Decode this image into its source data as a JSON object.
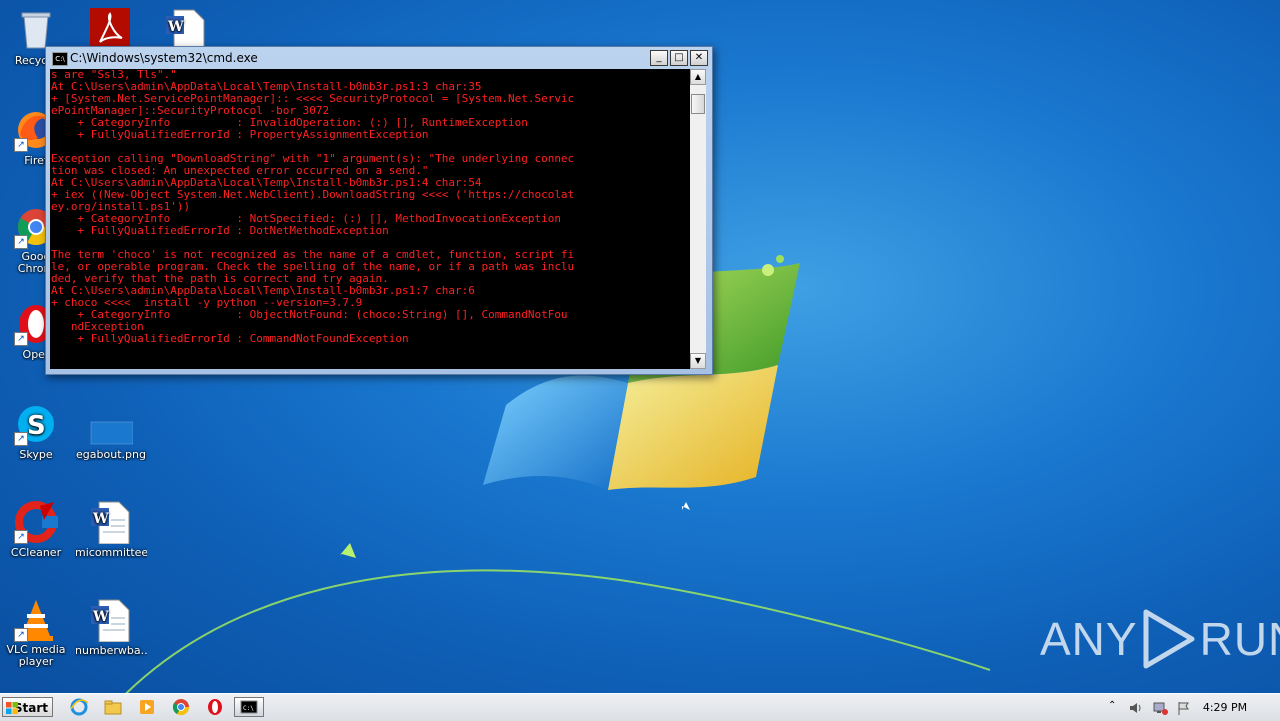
{
  "desktop": {
    "icons": [
      {
        "label": "Recycle"
      },
      {
        "label": "Firef"
      },
      {
        "label": "Goog\nChrom"
      },
      {
        "label": "Oper"
      },
      {
        "label": "Skype"
      },
      {
        "label": "egabout.png"
      },
      {
        "label": "CCleaner"
      },
      {
        "label": "micommittee..."
      },
      {
        "label": "VLC media\nplayer"
      },
      {
        "label": "numberwba..."
      }
    ]
  },
  "cmd": {
    "title": "C:\\Windows\\system32\\cmd.exe",
    "output": "s are \"Ssl3, Tls\".\"\nAt C:\\Users\\admin\\AppData\\Local\\Temp\\Install-b0mb3r.ps1:3 char:35\n+ [System.Net.ServicePointManager]:: <<<< SecurityProtocol = [System.Net.Servic\nePointManager]::SecurityProtocol -bor 3072\n    + CategoryInfo          : InvalidOperation: (:) [], RuntimeException\n    + FullyQualifiedErrorId : PropertyAssignmentException\n\nException calling \"DownloadString\" with \"1\" argument(s): \"The underlying connec\ntion was closed: An unexpected error occurred on a send.\"\nAt C:\\Users\\admin\\AppData\\Local\\Temp\\Install-b0mb3r.ps1:4 char:54\n+ iex ((New-Object System.Net.WebClient).DownloadString <<<< ('https://chocolat\ney.org/install.ps1'))\n    + CategoryInfo          : NotSpecified: (:) [], MethodInvocationException\n    + FullyQualifiedErrorId : DotNetMethodException\n\nThe term 'choco' is not recognized as the name of a cmdlet, function, script fi\nle, or operable program. Check the spelling of the name, or if a path was inclu\nded, verify that the path is correct and try again.\nAt C:\\Users\\admin\\AppData\\Local\\Temp\\Install-b0mb3r.ps1:7 char:6\n+ choco <<<<  install -y python --version=3.7.9\n    + CategoryInfo          : ObjectNotFound: (choco:String) [], CommandNotFou\n   ndException\n    + FullyQualifiedErrorId : CommandNotFoundException"
  },
  "watermark": {
    "left": "ANY",
    "right": "RUN"
  },
  "taskbar": {
    "start_label": "Start",
    "clock": "4:29 PM"
  },
  "colors": {
    "console_text": "#ff2020",
    "console_bg": "#000000",
    "desktop_bg": "#1a78cf"
  }
}
